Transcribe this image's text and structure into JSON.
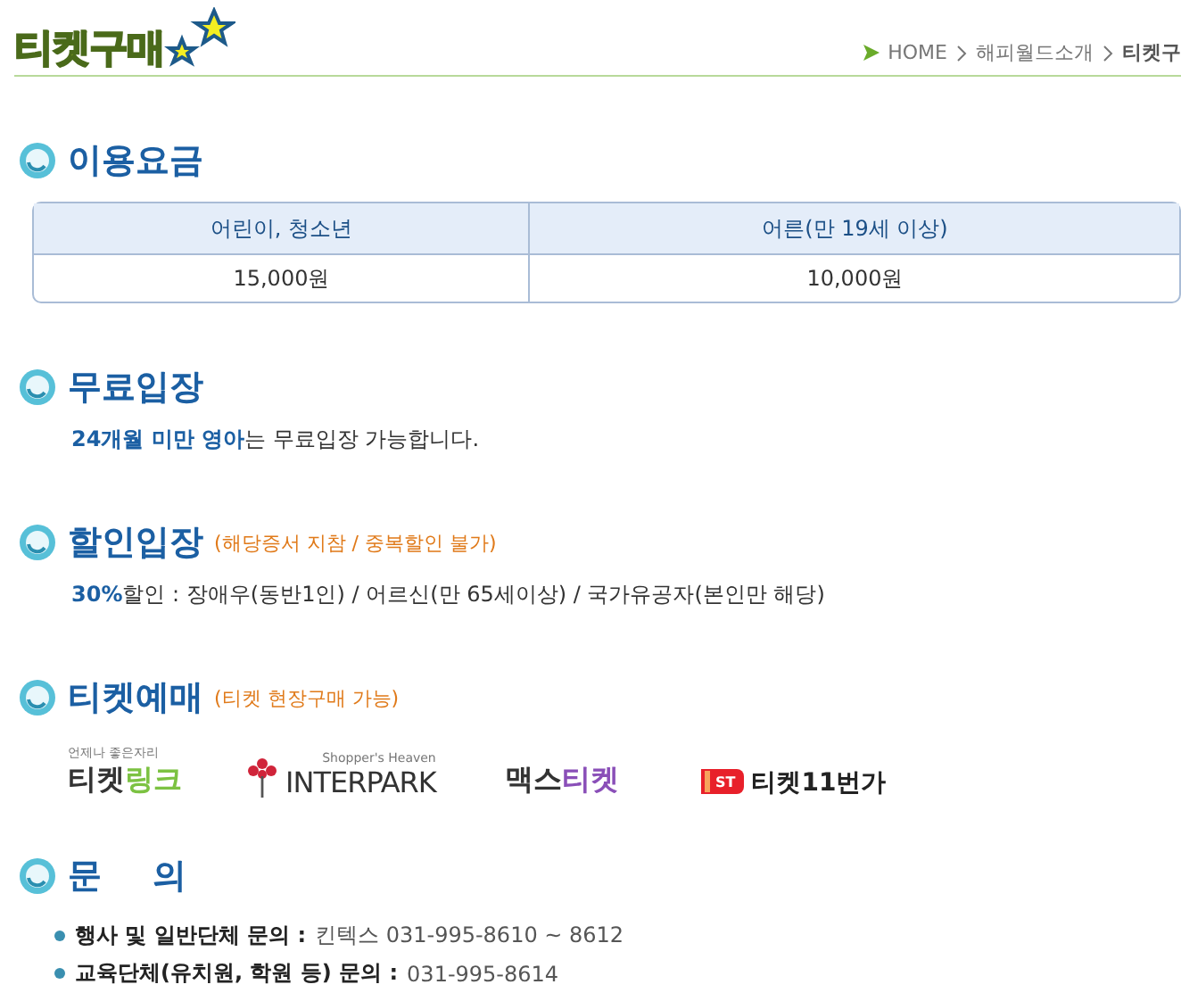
{
  "header": {
    "title": "티켓구매",
    "breadcrumb": [
      "HOME",
      "해피월드소개",
      "티켓구"
    ]
  },
  "sections": [
    {
      "kind": "table",
      "heading": "이용요금",
      "columns": [
        "어린이, 청소년",
        "어른(만 19세 이상)"
      ],
      "rows": [
        [
          "15,000원",
          "10,000원"
        ]
      ]
    },
    {
      "kind": "text",
      "heading": "무료입장",
      "text": "**24개월 미만 영아**는 무료입장 가능합니다."
    },
    {
      "kind": "text",
      "heading": "할인입장",
      "note": "(해당증서 지참 / 중복할인 불가)",
      "text": "**30%**할인 : 장애우(동반1인) / 어르신(만 65세이상) / 국가유공자(본인만 해당)"
    },
    {
      "kind": "vendors",
      "heading": "티켓예매",
      "note": "(티켓 현장구매 가능)",
      "vendors": [
        {
          "kind": "link",
          "caption": "언제나 좋은자리",
          "parts": [
            {
              "text": "티켓",
              "color": "#333333"
            },
            {
              "text": "링크",
              "color": "#7cc242"
            }
          ]
        },
        {
          "kind": "interpark",
          "caption": "Shopper's Heaven",
          "parts": [
            {
              "text": "INTERPARK",
              "color": "#333333"
            }
          ]
        },
        {
          "kind": "plain",
          "parts": [
            {
              "text": "맥스",
              "color": "#333333"
            },
            {
              "text": "티켓",
              "color": "#8a4fb8"
            }
          ]
        },
        {
          "kind": "eleven",
          "badge": "ST",
          "parts": [
            {
              "text": "티켓11번가",
              "color": "#222222"
            }
          ]
        }
      ]
    },
    {
      "kind": "contacts",
      "heading": "문 의",
      "contacts": [
        {
          "label": "행사 및 일반단체 문의 :",
          "value": "킨텍스 031-995-8610 ~ 8612"
        },
        {
          "label": "교육단체(유치원, 학원 등) 문의 :",
          "value": "031-995-8614"
        }
      ]
    }
  ]
}
